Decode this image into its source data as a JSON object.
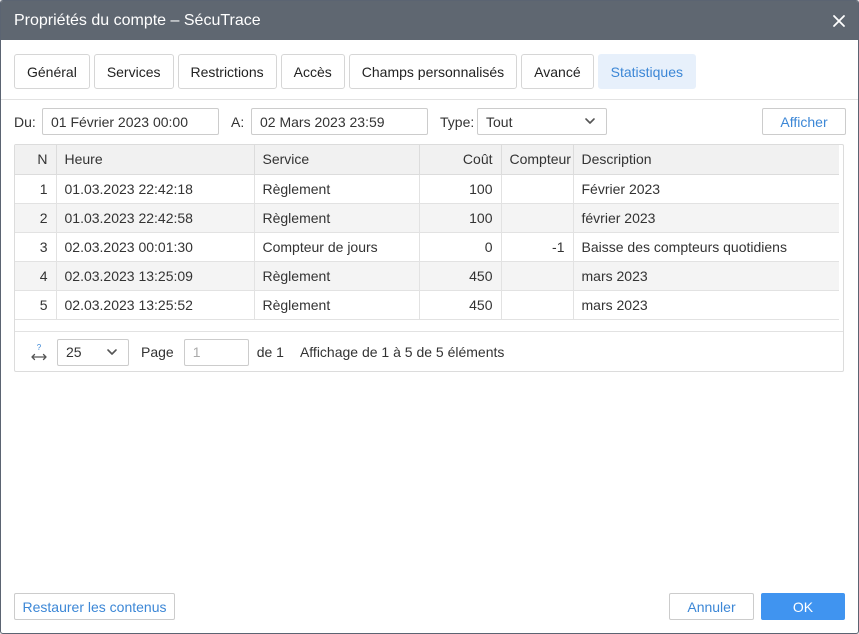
{
  "window": {
    "title": "Propriétés du compte – SécuTrace"
  },
  "tabs": [
    {
      "label": "Général"
    },
    {
      "label": "Services"
    },
    {
      "label": "Restrictions"
    },
    {
      "label": "Accès"
    },
    {
      "label": "Champs personnalisés"
    },
    {
      "label": "Avancé"
    },
    {
      "label": "Statistiques",
      "active": true
    }
  ],
  "filter": {
    "from_label": "Du:",
    "from_value": "01 Février 2023 00:00",
    "to_label": "A:",
    "to_value": "02 Mars 2023 23:59",
    "type_label": "Type:",
    "type_value": "Tout",
    "show_button": "Afficher"
  },
  "table": {
    "columns": [
      "N",
      "Heure",
      "Service",
      "Coût",
      "Compteur",
      "Description"
    ],
    "rows": [
      {
        "n": "1",
        "time": "01.03.2023 22:42:18",
        "service": "Règlement",
        "cost": "100",
        "counter": "",
        "description": "Février 2023"
      },
      {
        "n": "2",
        "time": "01.03.2023 22:42:58",
        "service": "Règlement",
        "cost": "100",
        "counter": "",
        "description": "février 2023"
      },
      {
        "n": "3",
        "time": "02.03.2023 00:01:30",
        "service": "Compteur de jours",
        "cost": "0",
        "counter": "-1",
        "description": "Baisse des compteurs quotidiens"
      },
      {
        "n": "4",
        "time": "02.03.2023 13:25:09",
        "service": "Règlement",
        "cost": "450",
        "counter": "",
        "description": "mars 2023"
      },
      {
        "n": "5",
        "time": "02.03.2023 13:25:52",
        "service": "Règlement",
        "cost": "450",
        "counter": "",
        "description": "mars 2023"
      }
    ]
  },
  "pager": {
    "page_size": "25",
    "page_label": "Page",
    "page_value": "1",
    "of_label": "de 1",
    "summary": "Affichage de 1 à 5 de 5 éléments"
  },
  "footer": {
    "restore": "Restaurer les contenus",
    "cancel": "Annuler",
    "ok": "OK"
  },
  "colors": {
    "titlebar": "#5f6771",
    "accent": "#3c87d6",
    "primary_button": "#4094f0",
    "active_tab_bg": "#e7f0fb"
  }
}
